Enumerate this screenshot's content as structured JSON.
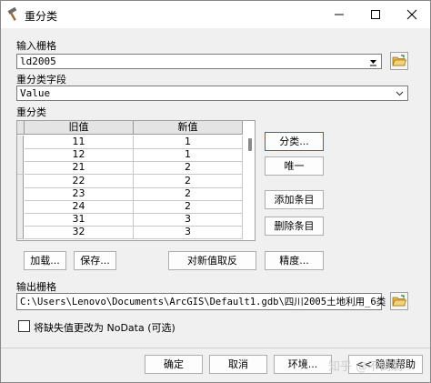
{
  "window": {
    "title": "重分类"
  },
  "input_raster": {
    "label": "输入栅格",
    "value": "ld2005"
  },
  "reclass_field": {
    "label": "重分类字段",
    "value": "Value"
  },
  "reclassification": {
    "label": "重分类",
    "columns": [
      "旧值",
      "新值"
    ],
    "rows": [
      {
        "old": "11",
        "new": "1"
      },
      {
        "old": "12",
        "new": "1"
      },
      {
        "old": "21",
        "new": "2"
      },
      {
        "old": "22",
        "new": "2"
      },
      {
        "old": "23",
        "new": "2"
      },
      {
        "old": "24",
        "new": "2"
      },
      {
        "old": "31",
        "new": "3"
      },
      {
        "old": "32",
        "new": "3"
      }
    ],
    "buttons": {
      "classify": "分类...",
      "unique": "唯一",
      "add_entry": "添加条目",
      "delete_entry": "删除条目",
      "load": "加载...",
      "save": "保存...",
      "reverse": "对新值取反",
      "precision": "精度..."
    }
  },
  "output_raster": {
    "label": "输出栅格",
    "value": "C:\\Users\\Lenovo\\Documents\\ArcGIS\\Default1.gdb\\四川2005土地利用_6类"
  },
  "nodata_checkbox": {
    "label": "将缺失值更改为 NoData (可选)",
    "checked": false
  },
  "footer": {
    "ok": "确定",
    "cancel": "取消",
    "environments": "环境...",
    "help": "<< 隐藏帮助"
  },
  "watermark": "知乎 @不倒翁",
  "colors": {
    "focus_border": "#0078d7",
    "window_bg": "#f0f0f0",
    "folder_icon": "#e8b84a"
  }
}
